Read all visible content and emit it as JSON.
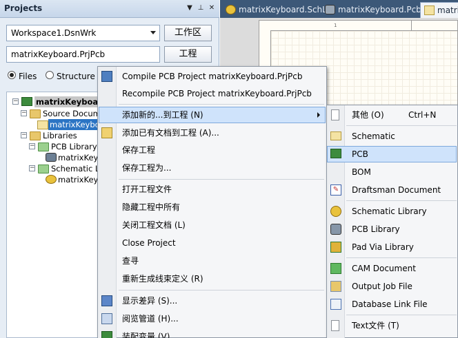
{
  "panel": {
    "title": "Projects",
    "workspace_combo": "Workspace1.DsnWrk",
    "workspace_button": "工作区",
    "project_combo": "matrixKeyboard.PrjPcb",
    "project_button": "工程",
    "view_files": "Files",
    "view_structure": "Structure",
    "view_selected": "Files"
  },
  "tabs": [
    {
      "label": "matrixKeyboard.SchLib",
      "icon": "schlib-icon",
      "active": false
    },
    {
      "label": "matrixKeyboard.PcbLib",
      "icon": "pcblib-icon",
      "active": false
    },
    {
      "label": "matrix",
      "icon": "sch-doc-icon",
      "active": true
    }
  ],
  "sheet": {
    "column_marker": "1"
  },
  "tree": {
    "project": "matrixKeyboard.P",
    "source_documents": "Source Docume",
    "source_file": "matrixKeyboa",
    "libraries": "Libraries",
    "pcb_library_documents": "PCB Library Do",
    "pcb_library_file": "matrixKeyb",
    "schematic_library_documents": "Schematic Lib",
    "schematic_library_file": "matrixKeyb"
  },
  "context_menu": {
    "items": [
      {
        "label": "Compile PCB Project matrixKeyboard.PrjPcb",
        "icon": "compile-icon"
      },
      {
        "label": "Recompile PCB Project matrixKeyboard.PrjPcb",
        "icon": ""
      },
      {
        "label": "添加新的...到工程 (N)",
        "icon": "",
        "submenu": true,
        "highlighted": true
      },
      {
        "label": "添加已有文档到工程 (A)...",
        "icon": "add-existing-icon"
      },
      {
        "label": "保存工程",
        "icon": ""
      },
      {
        "label": "保存工程为...",
        "icon": ""
      },
      {
        "label": "打开工程文件",
        "icon": ""
      },
      {
        "label": "隐藏工程中所有",
        "icon": ""
      },
      {
        "label": "关闭工程文档 (L)",
        "icon": ""
      },
      {
        "label": "Close Project",
        "icon": ""
      },
      {
        "label": "查寻",
        "icon": ""
      },
      {
        "label": "重新生成线束定义 (R)",
        "icon": ""
      },
      {
        "label": "显示差异 (S)...",
        "icon": "show-differences-icon"
      },
      {
        "label": "阅览管道 (H)...",
        "icon": "view-channels-icon"
      },
      {
        "label": "装配变量 (V)...",
        "icon": "variants-icon"
      }
    ]
  },
  "submenu": {
    "items": [
      {
        "label": "其他 (O)",
        "shortcut": "Ctrl+N",
        "icon": "blank-document-icon"
      },
      {
        "label": "Schematic",
        "icon": "schematic-icon"
      },
      {
        "label": "PCB",
        "icon": "pcb-icon",
        "highlighted": true
      },
      {
        "label": "BOM",
        "icon": "bom-icon"
      },
      {
        "label": "Draftsman Document",
        "icon": "draftsman-icon"
      },
      {
        "label": "Schematic Library",
        "icon": "schematic-library-icon"
      },
      {
        "label": "PCB Library",
        "icon": "pcb-library-icon"
      },
      {
        "label": "Pad Via Library",
        "icon": "pad-via-library-icon"
      },
      {
        "label": "CAM Document",
        "icon": "cam-document-icon"
      },
      {
        "label": "Output Job File",
        "icon": "output-job-icon"
      },
      {
        "label": "Database Link File",
        "icon": "database-link-icon"
      },
      {
        "label": "Text文件 (T)",
        "icon": "text-file-icon"
      }
    ]
  },
  "colors": {
    "panel_bg": "#e6edf5",
    "tab_strip": "#3c5878",
    "selection": "#2b74c4",
    "menu_highlight": "#cfe3fb"
  }
}
